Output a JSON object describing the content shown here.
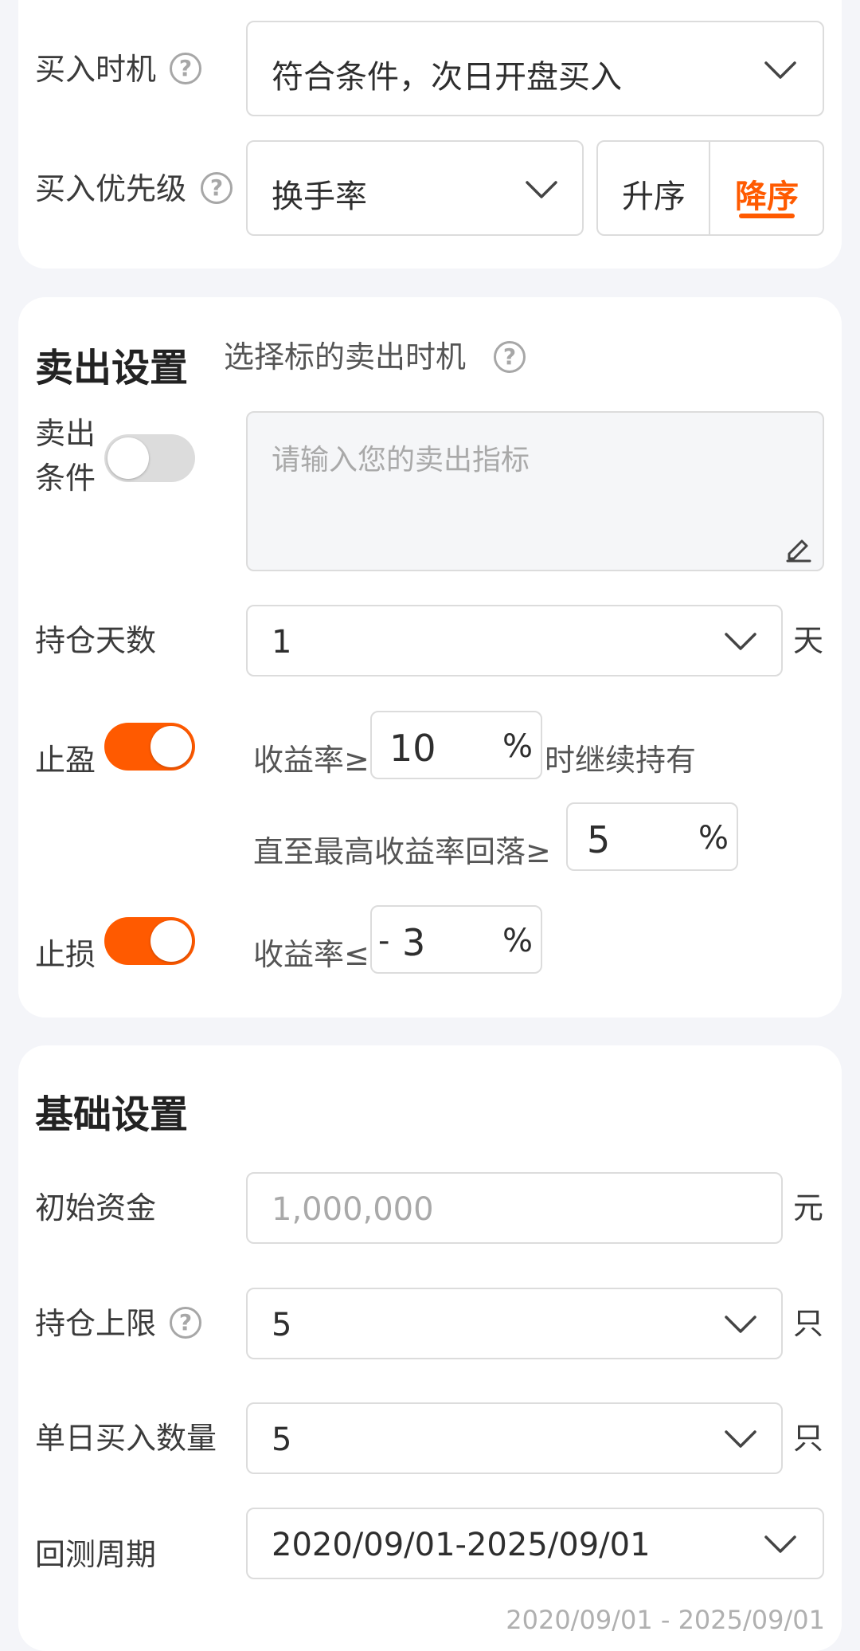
{
  "buy": {
    "timing_label": "买入时机",
    "timing_value": "符合条件，次日开盘买入",
    "priority_label": "买入优先级",
    "priority_value": "换手率",
    "asc_label": "升序",
    "desc_label": "降序",
    "help_symbol": "?"
  },
  "sell": {
    "title": "卖出设置",
    "subtitle": "选择标的卖出时机",
    "condition_label_line1": "卖出",
    "condition_label_line2": "条件",
    "condition_placeholder": "请输入您的卖出指标",
    "hold_days_label": "持仓天数",
    "hold_days_value": "1",
    "hold_days_unit": "天",
    "take_profit_label": "止盈",
    "take_profit_enabled": true,
    "tp_rate_prefix": "收益率≥",
    "tp_rate_value": "10",
    "tp_rate_suffix": "时继续持有",
    "tp_drawdown_prefix": "直至最高收益率回落≥",
    "tp_drawdown_value": "5",
    "stop_loss_label": "止损",
    "stop_loss_enabled": true,
    "sl_rate_prefix": "收益率≤",
    "sl_rate_sign": "-",
    "sl_rate_value": "3",
    "percent": "%"
  },
  "base": {
    "title": "基础设置",
    "capital_label": "初始资金",
    "capital_placeholder": "1,000,000",
    "capital_unit": "元",
    "max_positions_label": "持仓上限",
    "max_positions_value": "5",
    "max_positions_unit": "只",
    "daily_buy_label": "单日买入数量",
    "daily_buy_value": "5",
    "daily_buy_unit": "只",
    "period_label": "回测周期",
    "period_value": "2020/09/01-2025/09/01",
    "period_hint": "2020/09/01 - 2025/09/01"
  },
  "colors": {
    "accent": "#ff5a00",
    "background": "#f4f5f9",
    "card": "#ffffff",
    "border": "#dcdcdc"
  },
  "icons": {
    "dropdown": "chevron-down-icon",
    "help": "question-circle-icon",
    "edit": "pencil-icon"
  }
}
